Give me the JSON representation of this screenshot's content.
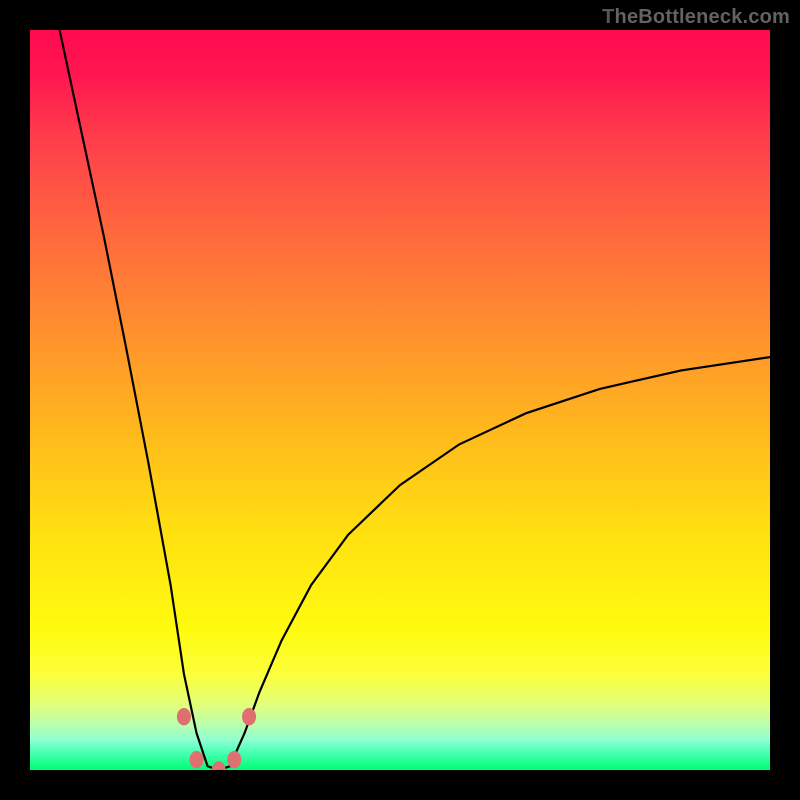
{
  "watermark": {
    "text": "TheBottleneck.com",
    "initial": "T"
  },
  "gradient_colors": {
    "top": "#ff0a4f",
    "mid_upper": "#ff942c",
    "mid": "#ffe010",
    "mid_lower": "#fcff3a",
    "bottom": "#00ff70"
  },
  "curve": {
    "stroke": "#000000",
    "stroke_width": 2.2
  },
  "dots": {
    "fill": "#e07070",
    "radius": 7
  },
  "chart_data": {
    "type": "line",
    "title": "",
    "xlabel": "",
    "ylabel": "",
    "xlim": [
      0,
      1
    ],
    "ylim": [
      0,
      1
    ],
    "note": "Axes are unlabeled in source image; x is normalized horizontal position, y is normalized height (0=bottom, 1=top). Curve is V-shaped: steep left descent from top, narrow trough ~x≈0.25, concave rise to ~y≈0.56 at right edge.",
    "series": [
      {
        "name": "curve",
        "x": [
          0.04,
          0.07,
          0.1,
          0.13,
          0.16,
          0.19,
          0.208,
          0.225,
          0.24,
          0.255,
          0.27,
          0.29,
          0.31,
          0.34,
          0.38,
          0.43,
          0.5,
          0.58,
          0.67,
          0.77,
          0.88,
          1.0
        ],
        "y": [
          1.0,
          0.86,
          0.72,
          0.57,
          0.415,
          0.25,
          0.13,
          0.05,
          0.005,
          0.0,
          0.005,
          0.05,
          0.105,
          0.175,
          0.25,
          0.318,
          0.385,
          0.44,
          0.482,
          0.515,
          0.54,
          0.558
        ]
      }
    ],
    "markers": [
      {
        "x": 0.208,
        "y": 0.072
      },
      {
        "x": 0.225,
        "y": 0.014
      },
      {
        "x": 0.255,
        "y": 0.0
      },
      {
        "x": 0.276,
        "y": 0.014
      },
      {
        "x": 0.296,
        "y": 0.072
      }
    ]
  }
}
